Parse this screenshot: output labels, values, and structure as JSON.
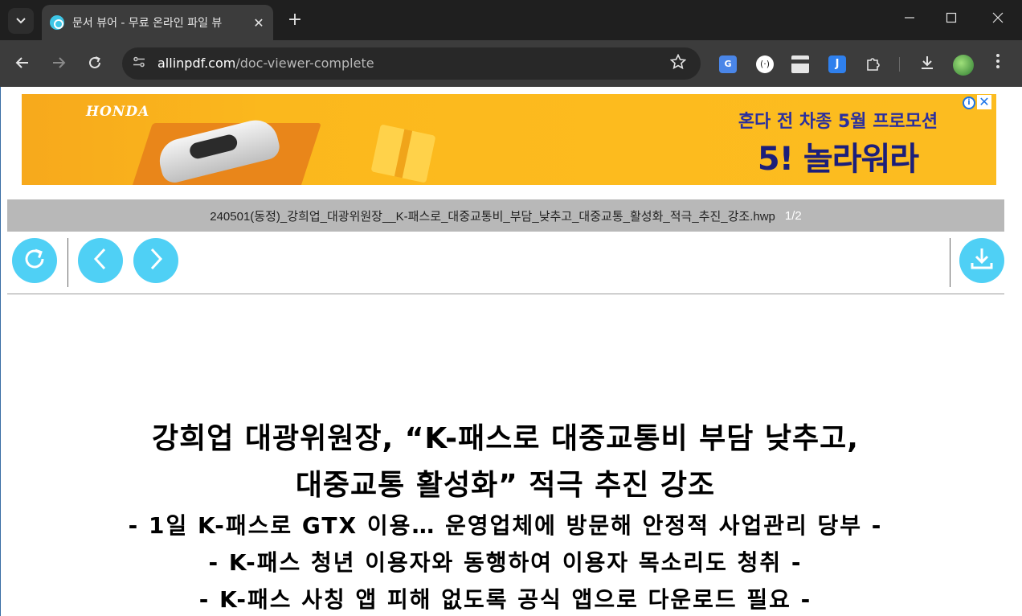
{
  "browser": {
    "tab_title": "문서 뷰어 - 무료 온라인 파일 뷰",
    "tab_close": "✕",
    "new_tab": "+",
    "url_host": "allinpdf.com",
    "url_path": "/doc-viewer-complete",
    "window_minimize": "—",
    "window_maximize": "☐",
    "window_close": "✕",
    "icons": {
      "tab_search": "chevron-down-icon",
      "back": "back-arrow-icon",
      "forward": "forward-arrow-icon",
      "reload": "reload-icon",
      "site_info": "site-info-icon",
      "bookmark": "star-icon",
      "extensions": "puzzle-icon",
      "downloads": "download-icon",
      "menu": "kebab-menu-icon"
    }
  },
  "ad": {
    "brand": "HONDA",
    "line1": "혼다 전 차종 5월 프로모션",
    "line2": "5! 놀라워라",
    "info": "i",
    "close": "✕",
    "colors": {
      "background": "#fdbb1e",
      "headline": "#1c1f7a"
    }
  },
  "viewer": {
    "file_name": "240501(동정)_강희업_대광위원장__K-패스로_대중교통비_부담_낮추고_대중교통_활성화_적극_추진_강조.hwp",
    "page_indicator": "1/2",
    "buttons": {
      "reload": "reload-icon",
      "previous": "chevron-left-icon",
      "next": "chevron-right-icon",
      "download": "download-icon"
    },
    "colors": {
      "button": "#4fd0f5",
      "filebar": "#b8b8b8"
    }
  },
  "document": {
    "title_line1": "강희업 대광위원장, “K-패스로 대중교통비 부담 낮추고,",
    "title_line2": "대중교통 활성화” 적극 추진 강조",
    "subtitle1": "- 1일 K-패스로 GTX 이용… 운영업체에 방문해 안정적 사업관리 당부 -",
    "subtitle2": "- K-패스 청년 이용자와 동행하여 이용자 목소리도 청취 -",
    "subtitle3": "- K-패스 사칭 앱 피해 없도록 공식 앱으로 다운로드 필요 -"
  }
}
